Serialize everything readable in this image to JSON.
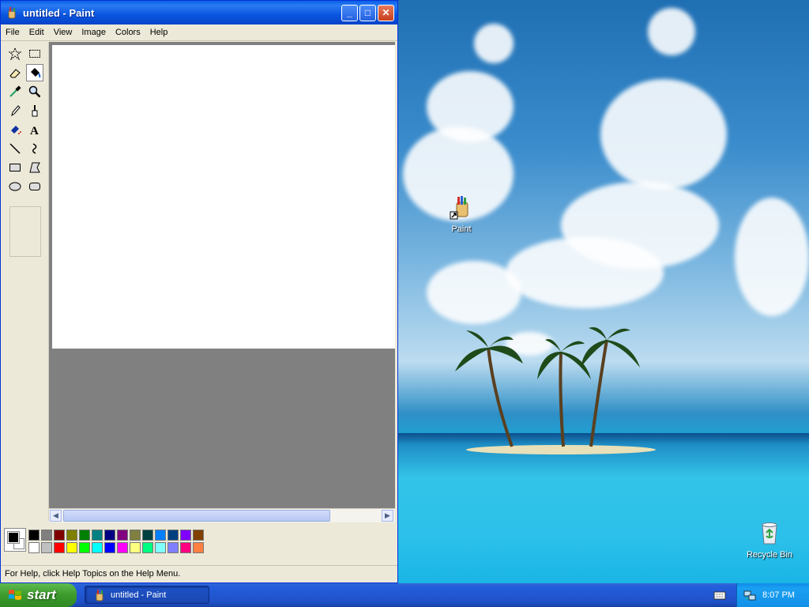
{
  "window": {
    "title": "untitled - Paint",
    "controls": {
      "minimize": "_",
      "maximize": "□",
      "close": "✕"
    }
  },
  "menu": [
    "File",
    "Edit",
    "View",
    "Image",
    "Colors",
    "Help"
  ],
  "tools": [
    {
      "name": "free-form-select",
      "icon": "free-select-icon"
    },
    {
      "name": "select",
      "icon": "rect-select-icon"
    },
    {
      "name": "eraser",
      "icon": "eraser-icon"
    },
    {
      "name": "fill-with-color",
      "icon": "fill-bucket-icon",
      "active": true
    },
    {
      "name": "pick-color",
      "icon": "eyedropper-icon"
    },
    {
      "name": "magnifier",
      "icon": "magnifier-icon"
    },
    {
      "name": "pencil",
      "icon": "pencil-icon"
    },
    {
      "name": "brush",
      "icon": "brush-icon"
    },
    {
      "name": "airbrush",
      "icon": "airbrush-icon"
    },
    {
      "name": "text",
      "icon": "text-icon"
    },
    {
      "name": "line",
      "icon": "line-icon"
    },
    {
      "name": "curve",
      "icon": "curve-icon"
    },
    {
      "name": "rectangle",
      "icon": "rectangle-icon"
    },
    {
      "name": "polygon",
      "icon": "polygon-icon"
    },
    {
      "name": "ellipse",
      "icon": "ellipse-icon"
    },
    {
      "name": "rounded-rectangle",
      "icon": "rounded-rect-icon"
    }
  ],
  "palette": {
    "foreground": "#000000",
    "background": "#ffffff",
    "row1": [
      "#000000",
      "#808080",
      "#800000",
      "#808000",
      "#008000",
      "#008080",
      "#000080",
      "#800080",
      "#808040",
      "#004040",
      "#0080ff",
      "#004080",
      "#8000ff",
      "#804000"
    ],
    "row2": [
      "#ffffff",
      "#c0c0c0",
      "#ff0000",
      "#ffff00",
      "#00ff00",
      "#00ffff",
      "#0000ff",
      "#ff00ff",
      "#ffff80",
      "#00ff80",
      "#80ffff",
      "#8080ff",
      "#ff0080",
      "#ff8040"
    ]
  },
  "status": "For Help, click Help Topics on the Help Menu.",
  "desktop": {
    "icons": [
      {
        "label": "Paint",
        "icon": "paint-shortcut-icon"
      },
      {
        "label": "Recycle Bin",
        "icon": "recycle-bin-icon"
      }
    ]
  },
  "taskbar": {
    "start": "start",
    "task_label": "untitled - Paint",
    "clock": "8:07 PM"
  }
}
